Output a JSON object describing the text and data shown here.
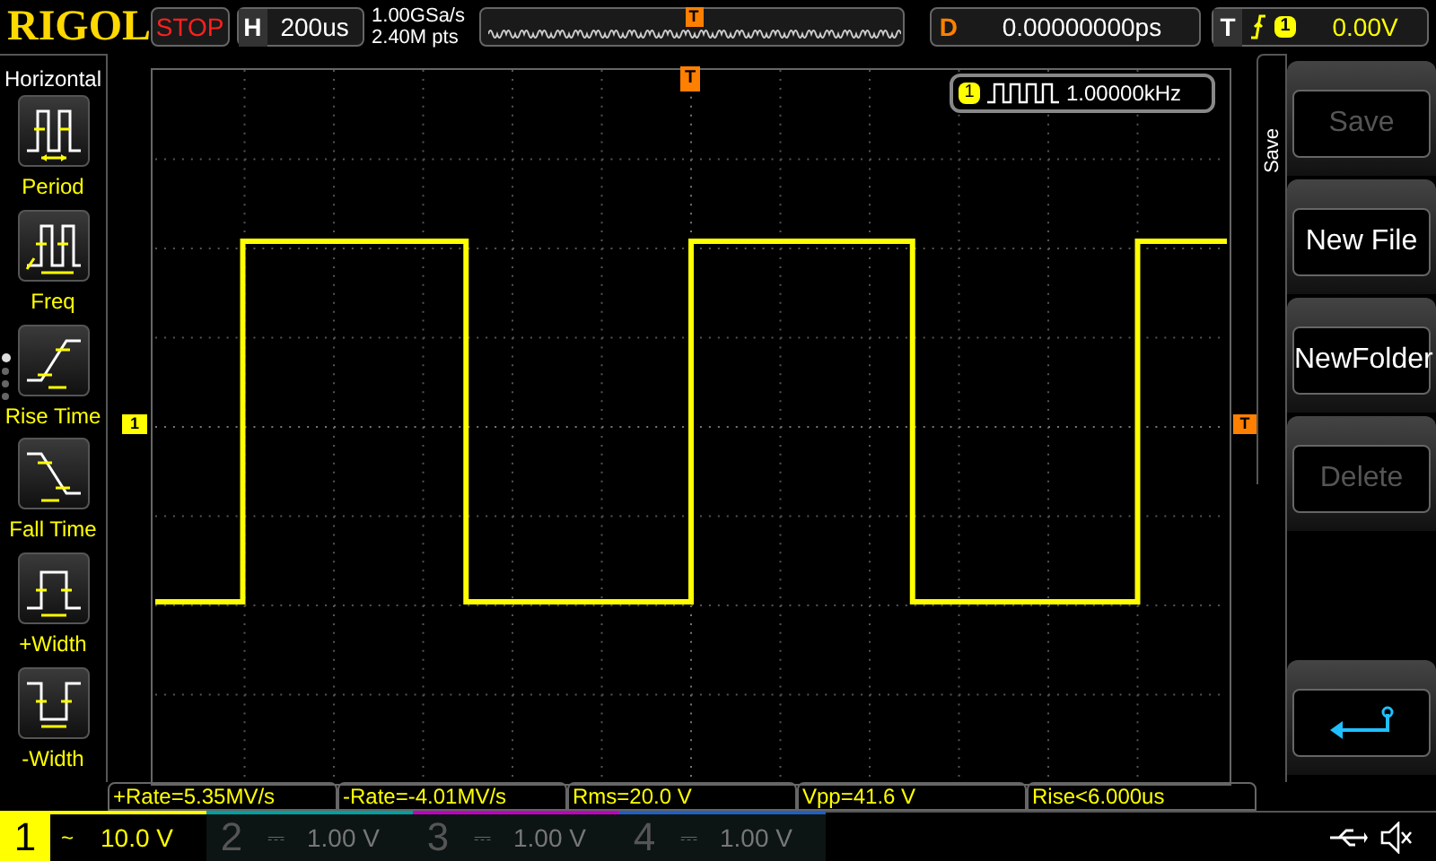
{
  "top_bar": {
    "logo": "RIGOL",
    "run_state": "STOP",
    "horizontal": {
      "label": "H",
      "value": "200us"
    },
    "sample_rate": "1.00GSa/s",
    "memory_depth": "2.40M pts",
    "position_marker": "T",
    "delay": {
      "label": "D",
      "value": "0.00000000ps"
    },
    "trigger": {
      "label": "T",
      "source": "1",
      "level": "0.00V"
    }
  },
  "left_panel": {
    "title": "Horizontal",
    "items": [
      {
        "label": "Period",
        "kind": "period"
      },
      {
        "label": "Freq",
        "kind": "freq"
      },
      {
        "label": "Rise Time",
        "kind": "rise"
      },
      {
        "label": "Fall Time",
        "kind": "fall"
      },
      {
        "label": "+Width",
        "kind": "pwidth"
      },
      {
        "label": "-Width",
        "kind": "nwidth"
      }
    ],
    "pages": [
      {
        "selected": true
      },
      {
        "selected": false
      },
      {
        "selected": false
      },
      {
        "selected": false
      }
    ]
  },
  "display": {
    "channel_marker": "1",
    "trigger_marker": "T",
    "top_trigger_marker": "T",
    "counter": {
      "channel": "1",
      "value": "1.00000kHz"
    }
  },
  "menu": {
    "title": "Save",
    "buttons": [
      {
        "label": "Save",
        "disabled": true
      },
      {
        "label": "New File",
        "disabled": false
      },
      {
        "label": "NewFolder",
        "disabled": false
      },
      {
        "label": "Delete",
        "disabled": true
      }
    ]
  },
  "measurements": [
    "+Rate=5.35MV/s",
    "-Rate=-4.01MV/s",
    "Rms=20.0 V",
    "Vpp=41.6 V",
    "Rise<6.000us"
  ],
  "channels": [
    {
      "number": "1",
      "coupling": "~",
      "scale": "10.0 V",
      "active": true,
      "color": "#ffff00"
    },
    {
      "number": "2",
      "coupling": "⎓",
      "scale": "1.00 V",
      "active": false,
      "color": "#00a0a0"
    },
    {
      "number": "3",
      "coupling": "⎓",
      "scale": "1.00 V",
      "active": false,
      "color": "#c000c0"
    },
    {
      "number": "4",
      "coupling": "⎓",
      "scale": "1.00 V",
      "active": false,
      "color": "#2060c0"
    }
  ]
}
